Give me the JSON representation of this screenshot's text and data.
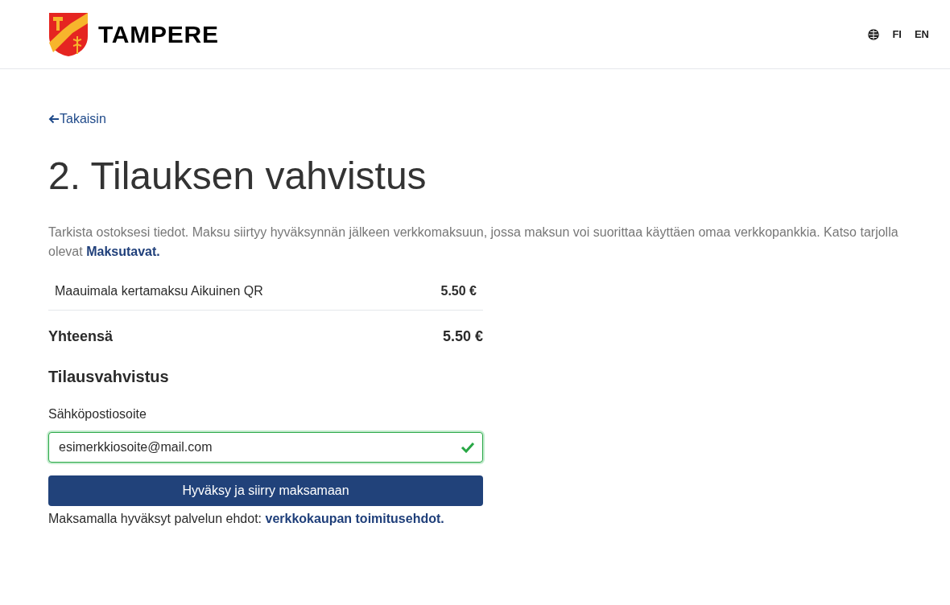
{
  "header": {
    "logo_text": "TAMPERE",
    "languages": [
      "FI",
      "EN"
    ]
  },
  "back_link": "Takaisin",
  "title": "2. Tilauksen vahvistus",
  "intro": {
    "text": "Tarkista ostoksesi tiedot. Maksu siirtyy hyväksynnän jälkeen verkkomaksuun, jossa maksun voi suorittaa käyttäen omaa verkkopankkia. Katso tarjolla olevat",
    "link": "Maksutavat."
  },
  "order_items": [
    {
      "name": "Maauimala kertamaksu Aikuinen QR",
      "price": "5.50 €"
    }
  ],
  "total": {
    "label": "Yhteensä",
    "price": "5.50 €"
  },
  "confirmation": {
    "heading": "Tilausvahvistus",
    "email_label": "Sähköpostiosoite",
    "email_value": "esimerkkiosoite@mail.com",
    "valid": true
  },
  "submit_button": "Hyväksy ja siirry maksamaan",
  "terms": {
    "text": "Maksamalla hyväksyt palvelun ehdot:",
    "link": "verkkokaupan toimitusehdot."
  }
}
